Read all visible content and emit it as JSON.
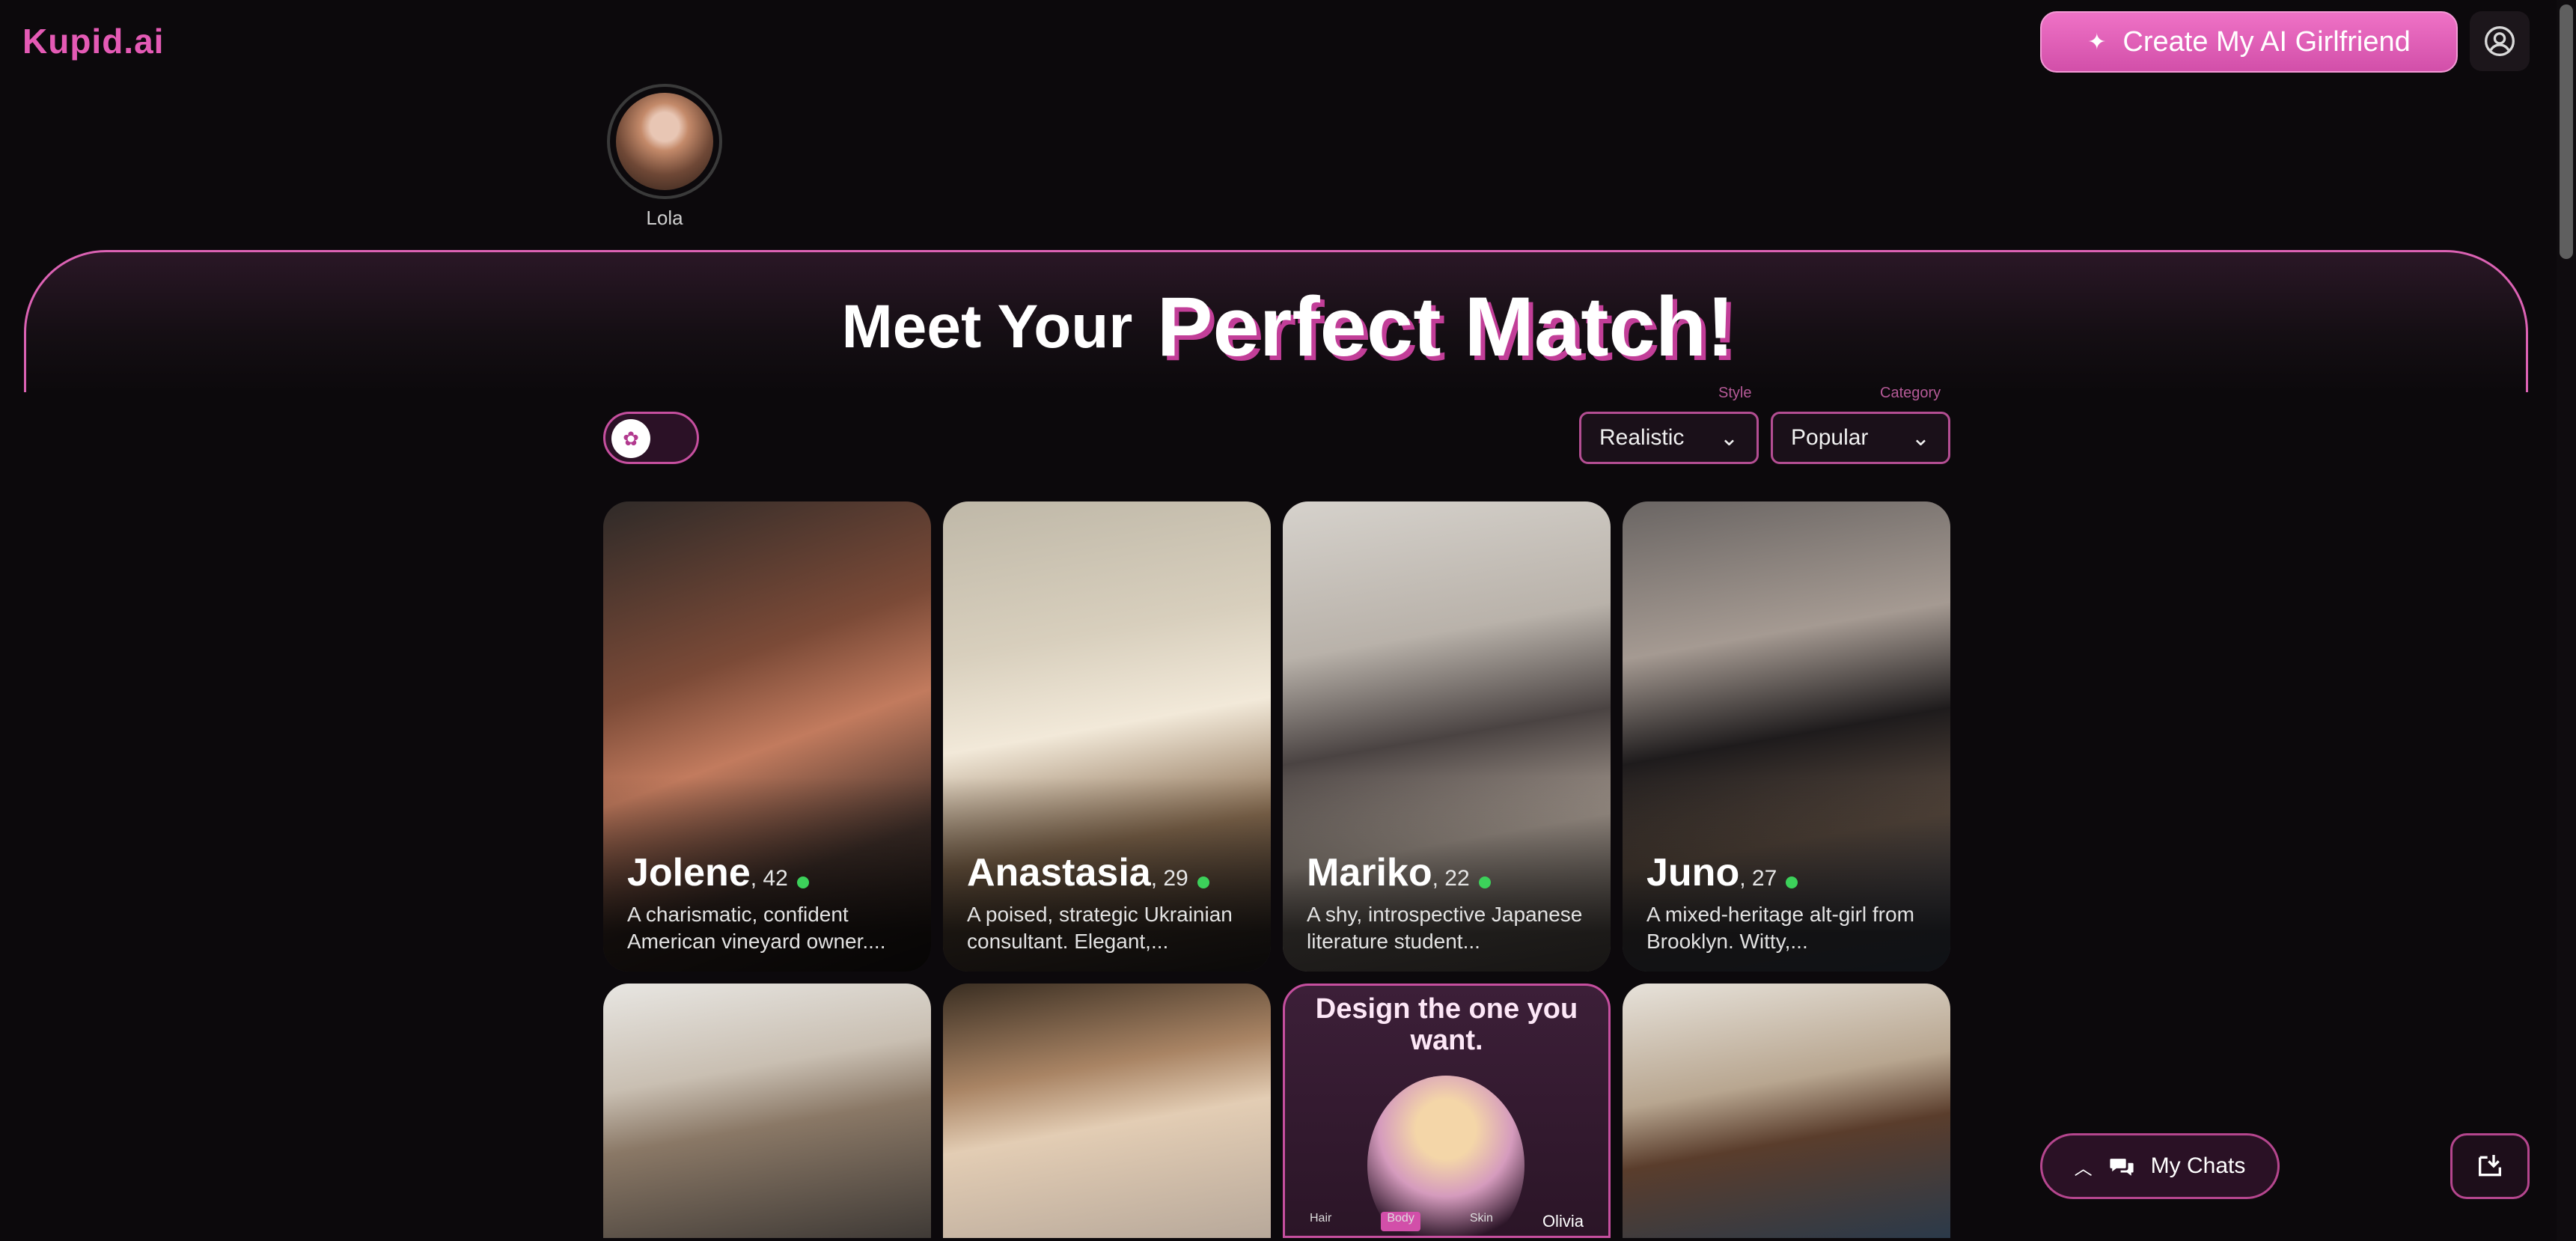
{
  "header": {
    "logo": "Kupid.ai",
    "create_label": "Create My AI Girlfriend"
  },
  "stories": [
    {
      "name": "Lola"
    }
  ],
  "hero": {
    "line1": "Meet Your",
    "line2": "Perfect Match!"
  },
  "filters": {
    "style_label": "Style",
    "style_value": "Realistic",
    "category_label": "Category",
    "category_value": "Popular"
  },
  "cards": [
    {
      "name": "Jolene",
      "age": ", 42",
      "desc": "A charismatic, confident American vineyard owner...."
    },
    {
      "name": "Anastasia",
      "age": ", 29",
      "desc": "A poised, strategic Ukrainian consultant. Elegant,..."
    },
    {
      "name": "Mariko",
      "age": ", 22",
      "desc": "A shy, introspective Japanese literature student..."
    },
    {
      "name": "Juno",
      "age": ", 27",
      "desc": "A mixed-heritage alt-girl from Brooklyn. Witty,..."
    }
  ],
  "promo": {
    "title": "Design the one you want.",
    "tag1": "Hair",
    "tag2": "Body",
    "tag3": "Skin",
    "name": "Olivia"
  },
  "chats": {
    "label": "My Chats"
  },
  "colors": {
    "brand": "#e45ab5",
    "accent": "#c64f9f",
    "online": "#3cd15a",
    "background": "#0c090c"
  }
}
